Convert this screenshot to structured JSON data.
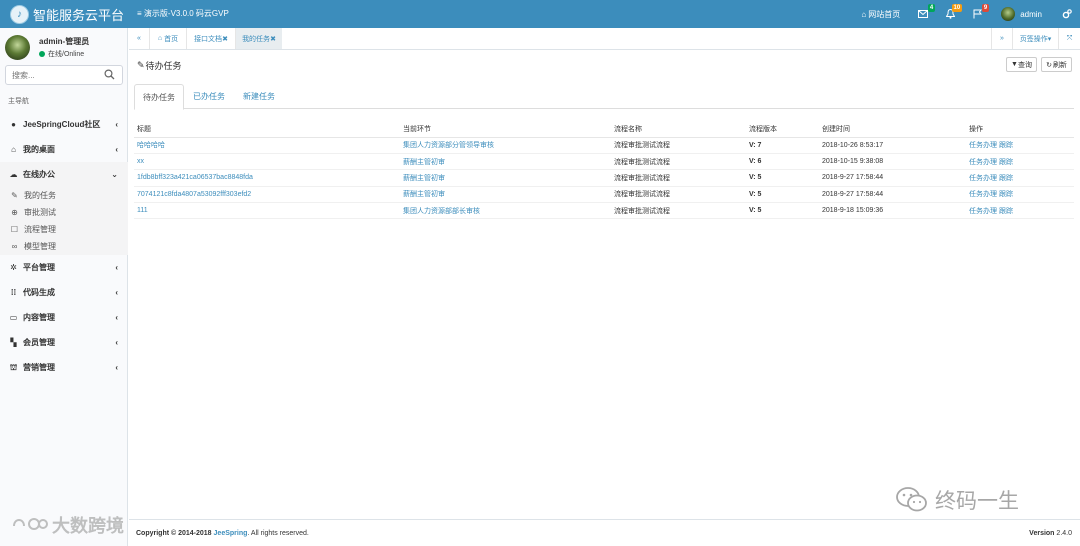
{
  "app": {
    "name": "智能服务云平台",
    "version_menu": "演示版-V3.0.0 码云GVP"
  },
  "topnav": {
    "home": "网站首页",
    "mail_count": "4",
    "bell_count": "10",
    "flag_count": "9",
    "username": "admin"
  },
  "sidebar": {
    "user_name": "admin-管理员",
    "status": "在线/Online",
    "search_placeholder": "搜索...",
    "nav_header": "主导航",
    "menu": [
      "JeeSpringCloud社区",
      "我的桌面",
      "在线办公"
    ],
    "sub_menu": [
      "我的任务",
      "审批测试",
      "流程管理",
      "模型管理"
    ],
    "menu2": [
      "平台管理",
      "代码生成",
      "内容管理",
      "会员管理",
      "营销管理"
    ]
  },
  "tabbar": {
    "tabs": [
      "首页",
      "接口文档",
      "我的任务"
    ],
    "page_ops": "页签操作"
  },
  "page": {
    "title": "待办任务",
    "btn_query": "查询",
    "btn_refresh": "刷新",
    "tabs": [
      "待办任务",
      "已办任务",
      "新建任务"
    ]
  },
  "table": {
    "headers": [
      "标题",
      "当前环节",
      "流程名称",
      "流程版本",
      "创建时间",
      "操作"
    ],
    "rows": [
      {
        "title": "哈哈哈哈",
        "node": "集团人力资源部分管领导审核",
        "process": "流程审批测试流程",
        "version": "V: 7",
        "created": "2018-10-26 8:53:17",
        "op1": "任务办理",
        "op2": "跟踪"
      },
      {
        "title": "xx",
        "node": "薪酬主管初审",
        "process": "流程审批测试流程",
        "version": "V: 6",
        "created": "2018-10-15 9:38:08",
        "op1": "任务办理",
        "op2": "跟踪"
      },
      {
        "title": "1fdb8bff323a421ca06537bac8848fda",
        "node": "薪酬主管初审",
        "process": "流程审批测试流程",
        "version": "V: 5",
        "created": "2018-9-27 17:58:44",
        "op1": "任务办理",
        "op2": "跟踪"
      },
      {
        "title": "7074121c8fda4807a53092fff303efd2",
        "node": "薪酬主管初审",
        "process": "流程审批测试流程",
        "version": "V: 5",
        "created": "2018-9-27 17:58:44",
        "op1": "任务办理",
        "op2": "跟踪"
      },
      {
        "title": "111",
        "node": "集团人力资源部部长审核",
        "process": "流程审批测试流程",
        "version": "V: 5",
        "created": "2018-9-18 15:09:36",
        "op1": "任务办理",
        "op2": "跟踪"
      }
    ]
  },
  "footer": {
    "copy_prefix": "Copyright © 2014-2018 ",
    "brand": "JeeSpring",
    "copy_suffix": ". All rights reserved.",
    "version_label": "Version",
    "version": "2.4.0"
  },
  "watermarks": {
    "right": "终码一生",
    "left": "大数跨境"
  },
  "colors": {
    "primary": "#3c8dbc",
    "online": "#00a65a",
    "badge_green": "#00a65a",
    "badge_orange": "#f39c12",
    "badge_red": "#dd4b39"
  },
  "icons": [
    "bars-icon",
    "home-icon",
    "mail-icon",
    "bell-icon",
    "flag-icon",
    "cogs-icon",
    "search-icon",
    "double-left-icon",
    "double-right-icon",
    "expand-icon",
    "edit-icon",
    "filter-icon",
    "refresh-icon",
    "chevron-left-icon"
  ]
}
